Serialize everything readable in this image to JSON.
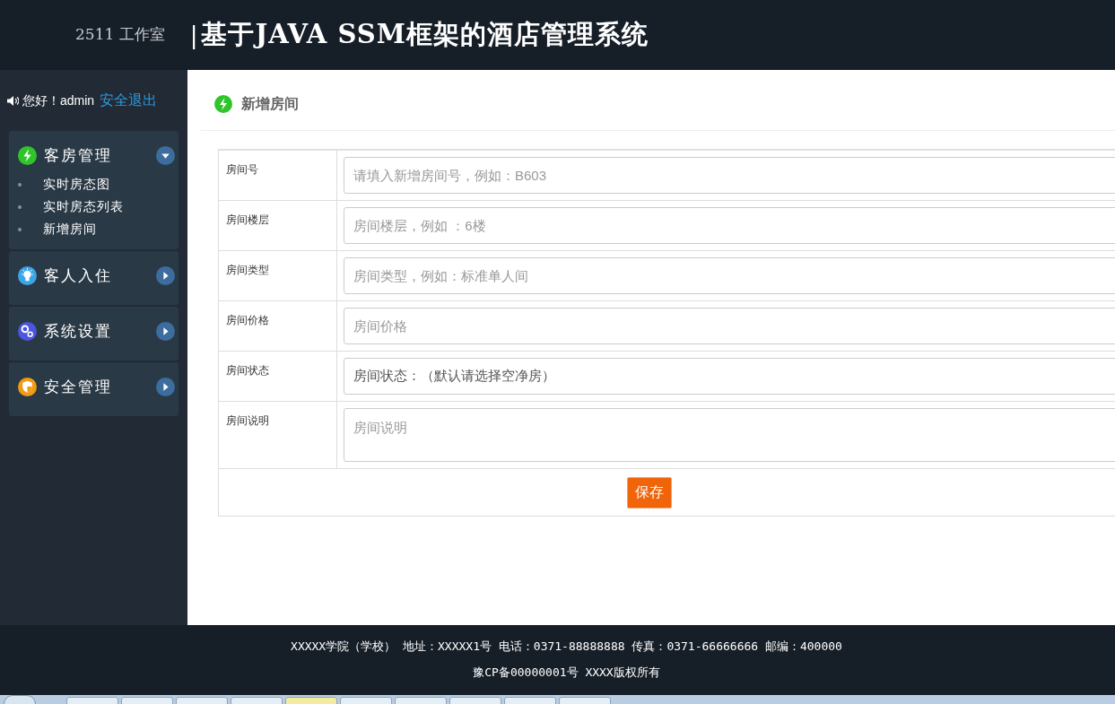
{
  "header": {
    "studio": "2511 工作室",
    "divider": "|",
    "title": "基于JAVA SSM框架的酒店管理系统"
  },
  "user_bar": {
    "greeting": "您好！admin",
    "logout": "安全退出"
  },
  "sidebar": {
    "groups": [
      {
        "label": "客房管理",
        "kind": "bolt",
        "expanded": true,
        "children": [
          {
            "label": "实时房态图"
          },
          {
            "label": "实时房态列表"
          },
          {
            "label": "新增房间"
          }
        ]
      },
      {
        "label": "客人入住",
        "kind": "bulb",
        "expanded": false
      },
      {
        "label": "系统设置",
        "kind": "gears",
        "expanded": false
      },
      {
        "label": "安全管理",
        "kind": "shield",
        "expanded": false
      }
    ]
  },
  "page": {
    "title": "新增房间"
  },
  "form": {
    "fields": [
      {
        "label": "房间号",
        "kind": "input",
        "placeholder": "请填入新增房间号，例如：B603"
      },
      {
        "label": "房间楼层",
        "kind": "input",
        "placeholder": "房间楼层，例如 ：6楼"
      },
      {
        "label": "房间类型",
        "kind": "input",
        "placeholder": "房间类型，例如：标准单人间"
      },
      {
        "label": "房间价格",
        "kind": "input",
        "placeholder": "房间价格"
      },
      {
        "label": "房间状态",
        "kind": "select",
        "value": "房间状态：（默认请选择空净房）"
      },
      {
        "label": "房间说明",
        "kind": "textarea",
        "placeholder": "房间说明"
      }
    ],
    "submit": "保存"
  },
  "footer": {
    "lines": [
      "XXXXX学院（学校） 地址：XXXXX1号 电话：0371-88888888 传真：0371-66666666 邮编：400000",
      "豫CP备00000001号 XXXX版权所有"
    ]
  }
}
